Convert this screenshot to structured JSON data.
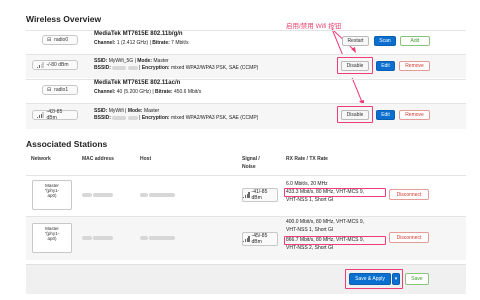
{
  "wireless_overview": {
    "title": "Wireless Overview",
    "radios": [
      {
        "device": "radio0",
        "name": "MediaTek MT7615E 802.11b/g/n",
        "channel_label": "Channel:",
        "channel": "1 (2.412 GHz)",
        "bitrate_label": "Bitrate:",
        "bitrate": "7 Mbit/s",
        "buttons": {
          "restart": "Restart",
          "scan": "Scan",
          "add": "Add"
        }
      },
      {
        "device": "radio1",
        "name": "MediaTek MT7615E 802.11ac/n",
        "channel_label": "Channel:",
        "channel": "40 (5.200 GHz)",
        "bitrate_label": "Bitrate:",
        "bitrate": "450.6 Mbit/s"
      }
    ],
    "networks": [
      {
        "signal": "-/-80 dBm",
        "ssid_label": "SSID:",
        "ssid": "MyWifi_5G",
        "mode_label": "Mode:",
        "mode": "Master",
        "bssid_label": "BSSID:",
        "encryption_label": "Encryption:",
        "encryption": "mixed WPA2/WPA3 PSK, SAE (CCMP)",
        "buttons": {
          "disable": "Disable",
          "edit": "Edit",
          "remove": "Remove"
        }
      },
      {
        "signal": "-42/-85 dBm",
        "ssid_label": "SSID:",
        "ssid": "MyWifi",
        "mode_label": "Mode:",
        "mode": "Master",
        "bssid_label": "BSSID:",
        "encryption_label": "Encryption:",
        "encryption": "mixed WPA2/WPA3 PSK, SAE (CCMP)",
        "buttons": {
          "disable": "Disable",
          "edit": "Edit",
          "remove": "Remove"
        }
      }
    ],
    "annotation": "启用/禁用 Wifi 按钮"
  },
  "associated_stations": {
    "title": "Associated Stations",
    "columns": {
      "network": "Network",
      "mac": "MAC address",
      "host": "Host",
      "signal": "Signal /",
      "noise": "Noise",
      "rates": "RX Rate / TX Rate"
    },
    "rows": [
      {
        "network_lines": [
          "Master",
          "\"(phy1-",
          "ap0)"
        ],
        "signal": "-41/-85 dBm",
        "rx": "6.0 Mbit/s, 20 MHz",
        "tx1": "433.3 Mbit/s, 80 MHz, VHT-MCS 9,",
        "tx2": "VHT-NSS 1, Short GI",
        "disconnect": "Disconnect"
      },
      {
        "network_lines": [
          "Master",
          "\"(phy1-",
          "ap0)"
        ],
        "signal": "-45/-85 dBm",
        "rx1": "400.0 Mbit/s, 80 MHz, VHT-MCS 9,",
        "rx2": "VHT-NSS 1, Short GI",
        "tx1": "866.7 Mbit/s, 80 MHz, VHT-MCS 9,",
        "tx2": "VHT-NSS 2, Short GI",
        "disconnect": "Disconnect"
      }
    ]
  },
  "footer": {
    "save_apply": "Save & Apply",
    "save": "Save"
  },
  "colors": {
    "accent": "#0b6fd0",
    "highlight": "#ee3d7a",
    "danger": "#d8372f",
    "success": "#3f9a2b"
  }
}
